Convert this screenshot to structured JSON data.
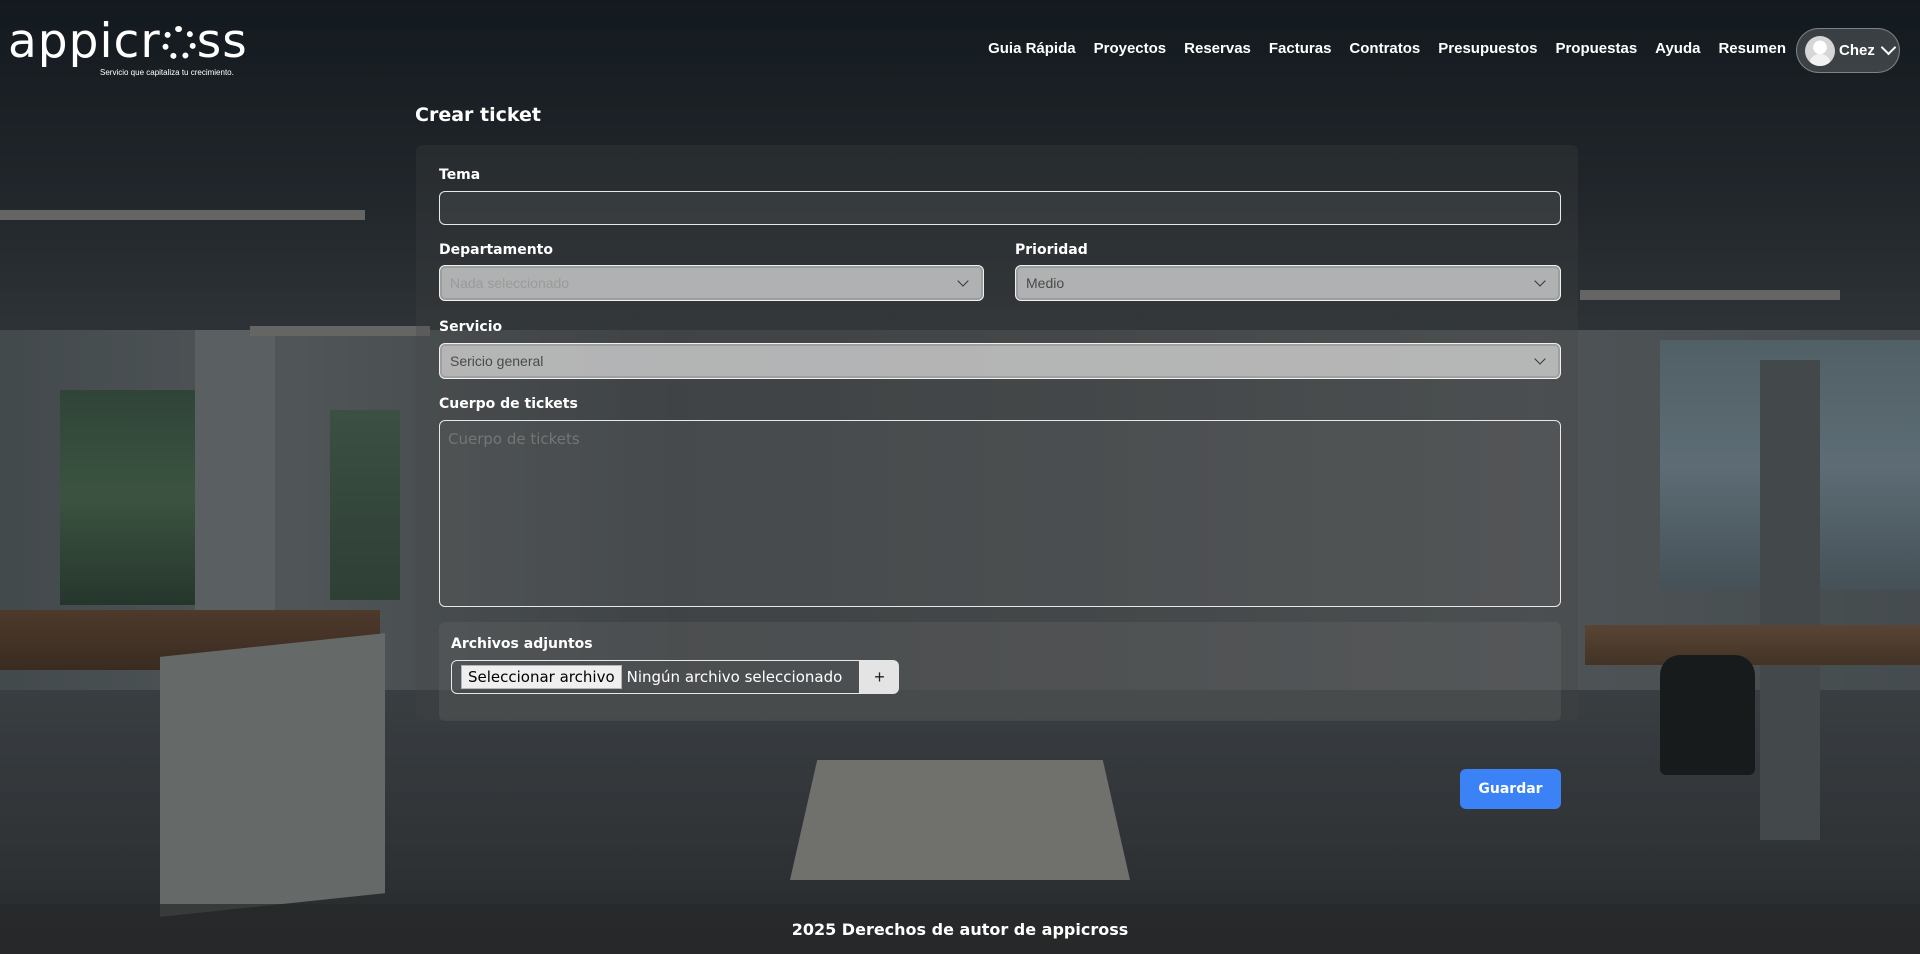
{
  "brand": {
    "logo_name": "appicross",
    "tagline": "Servicio que capitaliza tu crecimiento."
  },
  "nav": {
    "items": [
      "Guia Rápida",
      "Proyectos",
      "Reservas",
      "Facturas",
      "Contratos",
      "Presupuestos",
      "Propuestas",
      "Ayuda",
      "Resumen"
    ]
  },
  "user": {
    "name": "Chez"
  },
  "page": {
    "title": "Crear ticket"
  },
  "form": {
    "tema": {
      "label": "Tema",
      "value": ""
    },
    "departamento": {
      "label": "Departamento",
      "placeholder": "Nada seleccionado"
    },
    "prioridad": {
      "label": "Prioridad",
      "value": "Medio"
    },
    "servicio": {
      "label": "Servicio",
      "value": "Sericio general"
    },
    "cuerpo": {
      "label": "Cuerpo de tickets",
      "placeholder": "Cuerpo de tickets"
    },
    "adjuntos": {
      "label": "Archivos adjuntos",
      "button_label": "Seleccionar archivo",
      "status": "Ningún archivo seleccionado",
      "add_label": "+"
    },
    "save_label": "Guardar"
  },
  "footer": {
    "text": "2025 Derechos de autor de appicross"
  },
  "colors": {
    "accent": "#3b82f6"
  },
  "icons": {
    "user_menu": "chevron-down-icon",
    "select": "chevron-down-icon",
    "add": "plus-icon"
  }
}
